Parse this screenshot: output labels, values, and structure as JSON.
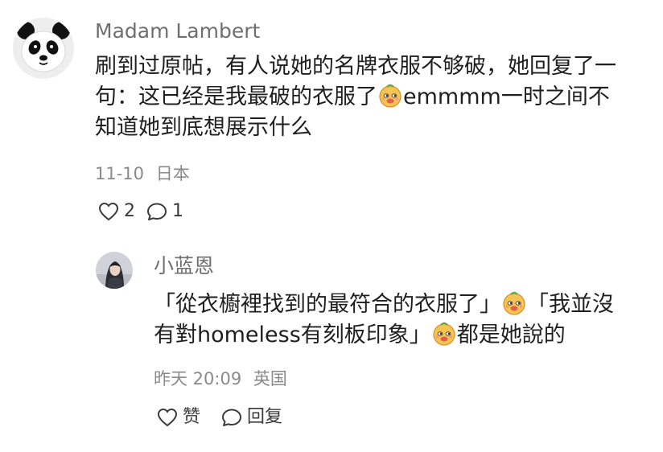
{
  "comment": {
    "username": "Madam Lambert",
    "text_lines": [
      "刷到过原帖，有人说她的名牌衣服不够破，她回复了一",
      "句：这已经是我最破的衣服了",
      "emmmm一时之间不",
      "知道她到底想展示什么"
    ],
    "date": "11-10",
    "location": "日本",
    "like_count": "2",
    "reply_count": "1",
    "avatar_icon": "panda-avatar",
    "emoji_icon": "smirking-face-emoji"
  },
  "reply": {
    "username": "小蓝恩",
    "text_lines": [
      "「從衣櫥裡找到的最符合的衣服了」",
      "「我並沒",
      "有對homeless有刻板印象」",
      "都是她說的"
    ],
    "date": "昨天 20:09",
    "location": "英国",
    "like_label": "赞",
    "reply_label": "回复",
    "avatar_icon": "girl-portrait-avatar",
    "emoji_icon": "smirking-face-emoji"
  },
  "colors": {
    "username": "#6f6f6f",
    "text": "#1f1f1f",
    "meta": "#8a8a8a",
    "icon": "#3a3a3a"
  }
}
